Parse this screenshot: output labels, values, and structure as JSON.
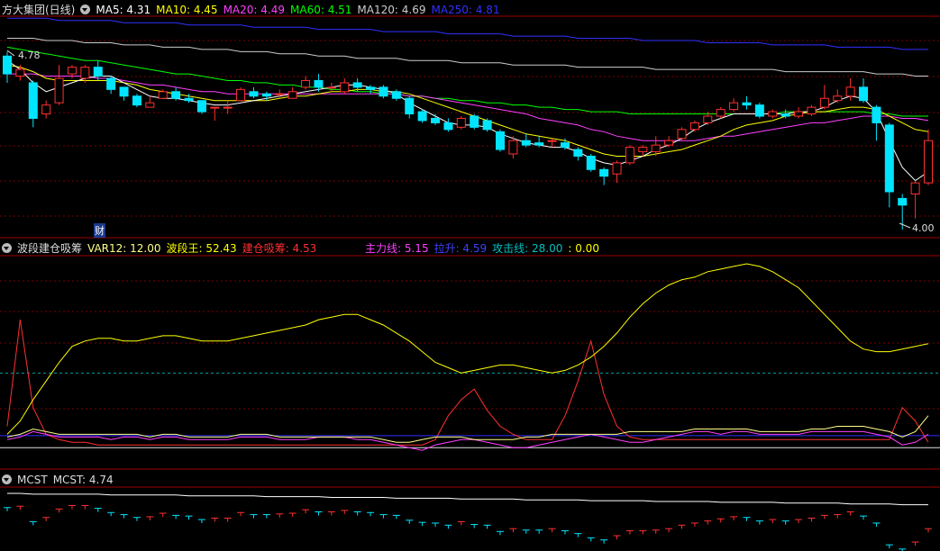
{
  "main": {
    "title": "方大集团(日线)",
    "ma": [
      {
        "label": "MA5: 4.31",
        "color": "#ffffff"
      },
      {
        "label": "MA10: 4.45",
        "color": "#ffff00"
      },
      {
        "label": "MA20: 4.49",
        "color": "#ff40ff"
      },
      {
        "label": "MA60: 4.51",
        "color": "#00ff00"
      },
      {
        "label": "MA120: 4.69",
        "color": "#cccccc"
      },
      {
        "label": "MA250: 4.81",
        "color": "#3030ff"
      }
    ],
    "high_label": "4.78",
    "low_label": "4.00",
    "cai_label": "财"
  },
  "osc": {
    "title": "波段建仓吸筹",
    "items": [
      {
        "label": "VAR12: 12.00",
        "color": "#ffff88"
      },
      {
        "label": "波段王: 52.43",
        "color": "#ffff00"
      },
      {
        "label": "建仓吸筹: 4.53",
        "color": "#ff3030"
      }
    ],
    "items2": [
      {
        "label": "主力线: 5.15",
        "color": "#ff40ff"
      },
      {
        "label": "拉升: 4.59",
        "color": "#4040ff"
      },
      {
        "label": "攻击线: 28.00",
        "color": "#00c0c0"
      },
      {
        "label": ": 0.00",
        "color": "#ffff00"
      }
    ]
  },
  "mcst": {
    "title": "MCST",
    "value": "MCST: 4.74"
  },
  "colors": {
    "up": "#ff3030",
    "down": "#00e5ff",
    "grid": "#7a0000",
    "border": "#a00000"
  },
  "chart_data": {
    "type": "candlestick",
    "price_range": [
      4.0,
      4.85
    ],
    "candles": [
      [
        4.78,
        4.7,
        4.8,
        4.66
      ],
      [
        4.69,
        4.72,
        4.74,
        4.67
      ],
      [
        4.66,
        4.5,
        4.67,
        4.46
      ],
      [
        4.52,
        4.56,
        4.58,
        4.5
      ],
      [
        4.57,
        4.68,
        4.74,
        4.56
      ],
      [
        4.7,
        4.73,
        4.74,
        4.68
      ],
      [
        4.68,
        4.73,
        4.74,
        4.66
      ],
      [
        4.73,
        4.69,
        4.76,
        4.67
      ],
      [
        4.68,
        4.63,
        4.69,
        4.61
      ],
      [
        4.64,
        4.6,
        4.64,
        4.58
      ],
      [
        4.6,
        4.56,
        4.61,
        4.55
      ],
      [
        4.55,
        4.57,
        4.6,
        4.55
      ],
      [
        4.59,
        4.62,
        4.63,
        4.59
      ],
      [
        4.62,
        4.59,
        4.64,
        4.58
      ],
      [
        4.59,
        4.58,
        4.61,
        4.57
      ],
      [
        4.58,
        4.53,
        4.58,
        4.52
      ],
      [
        4.55,
        4.55,
        4.55,
        4.49
      ],
      [
        4.55,
        4.55,
        4.58,
        4.52
      ],
      [
        4.58,
        4.63,
        4.64,
        4.58
      ],
      [
        4.62,
        4.6,
        4.64,
        4.59
      ],
      [
        4.61,
        4.6,
        4.62,
        4.58
      ],
      [
        4.61,
        4.61,
        4.63,
        4.59
      ],
      [
        4.59,
        4.62,
        4.64,
        4.59
      ],
      [
        4.64,
        4.67,
        4.69,
        4.63
      ],
      [
        4.67,
        4.64,
        4.7,
        4.62
      ],
      [
        4.64,
        4.64,
        4.66,
        4.62
      ],
      [
        4.62,
        4.66,
        4.68,
        4.61
      ],
      [
        4.66,
        4.64,
        4.68,
        4.62
      ],
      [
        4.64,
        4.63,
        4.65,
        4.61
      ],
      [
        4.64,
        4.6,
        4.65,
        4.59
      ],
      [
        4.62,
        4.59,
        4.63,
        4.58
      ],
      [
        4.59,
        4.52,
        4.6,
        4.5
      ],
      [
        4.53,
        4.49,
        4.54,
        4.48
      ],
      [
        4.5,
        4.48,
        4.52,
        4.47
      ],
      [
        4.48,
        4.45,
        4.5,
        4.44
      ],
      [
        4.46,
        4.5,
        4.51,
        4.45
      ],
      [
        4.51,
        4.46,
        4.52,
        4.45
      ],
      [
        4.49,
        4.45,
        4.5,
        4.44
      ],
      [
        4.44,
        4.36,
        4.45,
        4.35
      ],
      [
        4.34,
        4.4,
        4.42,
        4.32
      ],
      [
        4.4,
        4.38,
        4.43,
        4.37
      ],
      [
        4.39,
        4.38,
        4.42,
        4.37
      ],
      [
        4.4,
        4.4,
        4.41,
        4.37
      ],
      [
        4.39,
        4.37,
        4.41,
        4.36
      ],
      [
        4.36,
        4.33,
        4.37,
        4.31
      ],
      [
        4.33,
        4.27,
        4.34,
        4.26
      ],
      [
        4.27,
        4.24,
        4.28,
        4.2
      ],
      [
        4.25,
        4.3,
        4.31,
        4.21
      ],
      [
        4.3,
        4.37,
        4.38,
        4.29
      ],
      [
        4.35,
        4.37,
        4.38,
        4.33
      ],
      [
        4.35,
        4.38,
        4.42,
        4.33
      ],
      [
        4.38,
        4.4,
        4.42,
        4.37
      ],
      [
        4.41,
        4.45,
        4.46,
        4.4
      ],
      [
        4.45,
        4.48,
        4.49,
        4.44
      ],
      [
        4.48,
        4.51,
        4.53,
        4.47
      ],
      [
        4.51,
        4.54,
        4.55,
        4.5
      ],
      [
        4.54,
        4.57,
        4.59,
        4.53
      ],
      [
        4.57,
        4.56,
        4.6,
        4.54
      ],
      [
        4.56,
        4.51,
        4.57,
        4.5
      ],
      [
        4.51,
        4.53,
        4.54,
        4.5
      ],
      [
        4.52,
        4.51,
        4.54,
        4.5
      ],
      [
        4.51,
        4.53,
        4.55,
        4.5
      ],
      [
        4.52,
        4.55,
        4.56,
        4.51
      ],
      [
        4.55,
        4.59,
        4.65,
        4.54
      ],
      [
        4.58,
        4.6,
        4.63,
        4.57
      ],
      [
        4.6,
        4.64,
        4.68,
        4.58
      ],
      [
        4.64,
        4.58,
        4.68,
        4.57
      ],
      [
        4.55,
        4.48,
        4.56,
        4.4
      ],
      [
        4.47,
        4.17,
        4.48,
        4.1
      ],
      [
        4.14,
        4.11,
        4.16,
        4.0
      ],
      [
        4.16,
        4.21,
        4.22,
        4.05
      ],
      [
        4.21,
        4.4,
        4.45,
        4.2
      ]
    ],
    "ma5": [
      4.76,
      4.72,
      4.66,
      4.62,
      4.64,
      4.66,
      4.68,
      4.69,
      4.69,
      4.66,
      4.63,
      4.6,
      4.59,
      4.59,
      4.58,
      4.57,
      4.56,
      4.56,
      4.57,
      4.58,
      4.59,
      4.6,
      4.61,
      4.62,
      4.63,
      4.64,
      4.65,
      4.65,
      4.64,
      4.63,
      4.61,
      4.57,
      4.54,
      4.51,
      4.48,
      4.47,
      4.47,
      4.46,
      4.43,
      4.41,
      4.39,
      4.38,
      4.37,
      4.37,
      4.35,
      4.32,
      4.3,
      4.29,
      4.31,
      4.33,
      4.36,
      4.38,
      4.41,
      4.45,
      4.48,
      4.5,
      4.52,
      4.52,
      4.52,
      4.52,
      4.52,
      4.53,
      4.53,
      4.55,
      4.58,
      4.6,
      4.59,
      4.53,
      4.4,
      4.28,
      4.22,
      4.26
    ],
    "ma10": [
      4.74,
      4.73,
      4.71,
      4.68,
      4.67,
      4.67,
      4.67,
      4.67,
      4.67,
      4.66,
      4.65,
      4.63,
      4.62,
      4.61,
      4.6,
      4.59,
      4.58,
      4.58,
      4.58,
      4.58,
      4.58,
      4.59,
      4.6,
      4.6,
      4.61,
      4.62,
      4.62,
      4.63,
      4.63,
      4.62,
      4.62,
      4.61,
      4.59,
      4.57,
      4.55,
      4.53,
      4.51,
      4.49,
      4.47,
      4.45,
      4.43,
      4.42,
      4.41,
      4.4,
      4.38,
      4.36,
      4.34,
      4.33,
      4.33,
      4.33,
      4.34,
      4.35,
      4.36,
      4.38,
      4.4,
      4.42,
      4.45,
      4.47,
      4.48,
      4.49,
      4.51,
      4.52,
      4.53,
      4.53,
      4.54,
      4.55,
      4.55,
      4.54,
      4.51,
      4.48,
      4.45,
      4.44
    ],
    "ma20": [
      4.7,
      4.7,
      4.7,
      4.69,
      4.69,
      4.69,
      4.69,
      4.68,
      4.68,
      4.67,
      4.66,
      4.65,
      4.65,
      4.64,
      4.63,
      4.62,
      4.62,
      4.61,
      4.61,
      4.61,
      4.61,
      4.61,
      4.61,
      4.61,
      4.61,
      4.61,
      4.61,
      4.61,
      4.61,
      4.61,
      4.61,
      4.6,
      4.6,
      4.59,
      4.58,
      4.57,
      4.56,
      4.55,
      4.54,
      4.53,
      4.52,
      4.5,
      4.49,
      4.48,
      4.47,
      4.45,
      4.44,
      4.42,
      4.41,
      4.4,
      4.4,
      4.4,
      4.4,
      4.4,
      4.41,
      4.42,
      4.42,
      4.43,
      4.44,
      4.45,
      4.46,
      4.47,
      4.48,
      4.48,
      4.49,
      4.5,
      4.51,
      4.51,
      4.51,
      4.5,
      4.5,
      4.49
    ],
    "ma60": [
      4.82,
      4.81,
      4.8,
      4.79,
      4.78,
      4.77,
      4.76,
      4.76,
      4.75,
      4.74,
      4.73,
      4.72,
      4.71,
      4.7,
      4.7,
      4.69,
      4.68,
      4.67,
      4.67,
      4.66,
      4.66,
      4.65,
      4.65,
      4.64,
      4.64,
      4.63,
      4.63,
      4.62,
      4.62,
      4.61,
      4.61,
      4.6,
      4.6,
      4.59,
      4.59,
      4.58,
      4.58,
      4.57,
      4.57,
      4.56,
      4.56,
      4.55,
      4.55,
      4.54,
      4.54,
      4.53,
      4.53,
      4.53,
      4.52,
      4.52,
      4.52,
      4.52,
      4.52,
      4.52,
      4.52,
      4.52,
      4.52,
      4.52,
      4.52,
      4.52,
      4.53,
      4.53,
      4.53,
      4.53,
      4.53,
      4.53,
      4.53,
      4.52,
      4.52,
      4.51,
      4.51,
      4.51
    ],
    "ma120": [
      4.86,
      4.86,
      4.86,
      4.85,
      4.85,
      4.85,
      4.84,
      4.84,
      4.84,
      4.83,
      4.83,
      4.83,
      4.82,
      4.82,
      4.82,
      4.81,
      4.81,
      4.81,
      4.8,
      4.8,
      4.8,
      4.79,
      4.79,
      4.79,
      4.78,
      4.78,
      4.78,
      4.77,
      4.77,
      4.77,
      4.77,
      4.76,
      4.76,
      4.76,
      4.76,
      4.75,
      4.75,
      4.75,
      4.75,
      4.74,
      4.74,
      4.74,
      4.74,
      4.74,
      4.73,
      4.73,
      4.73,
      4.73,
      4.73,
      4.73,
      4.72,
      4.72,
      4.72,
      4.72,
      4.72,
      4.72,
      4.72,
      4.72,
      4.72,
      4.72,
      4.71,
      4.71,
      4.71,
      4.71,
      4.71,
      4.71,
      4.71,
      4.7,
      4.7,
      4.7,
      4.69,
      4.69
    ],
    "ma250": [
      4.95,
      4.95,
      4.95,
      4.95,
      4.94,
      4.94,
      4.94,
      4.94,
      4.94,
      4.93,
      4.93,
      4.93,
      4.93,
      4.93,
      4.92,
      4.92,
      4.92,
      4.92,
      4.92,
      4.91,
      4.91,
      4.91,
      4.91,
      4.91,
      4.9,
      4.9,
      4.9,
      4.9,
      4.9,
      4.89,
      4.89,
      4.89,
      4.89,
      4.89,
      4.88,
      4.88,
      4.88,
      4.88,
      4.88,
      4.87,
      4.87,
      4.87,
      4.87,
      4.87,
      4.86,
      4.86,
      4.86,
      4.86,
      4.86,
      4.85,
      4.85,
      4.85,
      4.85,
      4.85,
      4.84,
      4.84,
      4.84,
      4.84,
      4.84,
      4.83,
      4.83,
      4.83,
      4.83,
      4.83,
      4.82,
      4.82,
      4.82,
      4.82,
      4.82,
      4.81,
      4.81,
      4.81
    ],
    "osc_range": [
      -5,
      70
    ],
    "wave_king": [
      5,
      10,
      18,
      25,
      32,
      38,
      40,
      41,
      41,
      40,
      40,
      41,
      42,
      42,
      41,
      40,
      40,
      40,
      41,
      42,
      43,
      44,
      45,
      46,
      48,
      49,
      50,
      50,
      48,
      46,
      43,
      40,
      36,
      32,
      30,
      28,
      29,
      30,
      31,
      31,
      30,
      29,
      28,
      29,
      31,
      34,
      38,
      43,
      49,
      54,
      58,
      61,
      63,
      64,
      66,
      67,
      68,
      69,
      68,
      66,
      63,
      60,
      55,
      50,
      45,
      40,
      37,
      36,
      36,
      37,
      38,
      39
    ],
    "build": [
      8,
      48,
      15,
      5,
      3,
      2,
      2,
      1,
      1,
      1,
      1,
      1,
      1,
      1,
      1,
      1,
      1,
      1,
      1,
      1,
      1,
      1,
      1,
      1,
      1,
      1,
      1,
      1,
      1,
      1,
      1,
      1,
      1,
      3,
      12,
      18,
      22,
      14,
      8,
      5,
      3,
      3,
      3,
      12,
      25,
      40,
      20,
      8,
      4,
      3,
      3,
      3,
      3,
      3,
      3,
      3,
      3,
      3,
      3,
      3,
      3,
      3,
      3,
      3,
      3,
      3,
      3,
      3,
      3,
      15,
      10,
      2
    ],
    "main_force": [
      3,
      4,
      6,
      5,
      4,
      4,
      4,
      4,
      3,
      4,
      4,
      3,
      4,
      4,
      3,
      3,
      3,
      3,
      4,
      4,
      4,
      3,
      3,
      3,
      4,
      4,
      4,
      3,
      3,
      2,
      1,
      0,
      -1,
      1,
      2,
      3,
      3,
      2,
      1,
      0,
      0,
      1,
      2,
      3,
      4,
      5,
      4,
      3,
      2,
      2,
      3,
      4,
      5,
      6,
      6,
      5,
      6,
      6,
      5,
      5,
      5,
      5,
      6,
      6,
      6,
      6,
      6,
      5,
      4,
      1,
      2,
      5
    ],
    "lift": [
      2,
      3,
      3,
      3,
      3,
      3,
      3,
      3,
      3,
      3,
      3,
      3,
      3,
      3,
      3,
      3,
      3,
      3,
      3,
      3,
      3,
      3,
      3,
      3,
      3,
      3,
      3,
      3,
      3,
      3,
      3,
      3,
      3,
      3,
      3,
      3,
      3,
      3,
      3,
      3,
      3,
      3,
      3,
      3,
      3,
      3,
      3,
      3,
      3,
      3,
      3,
      3,
      3,
      3,
      3,
      3,
      3,
      3,
      3,
      3,
      3,
      3,
      3,
      3,
      3,
      3,
      3,
      3,
      3,
      3,
      3,
      3
    ],
    "var12": [
      4,
      5,
      7,
      6,
      5,
      5,
      5,
      5,
      5,
      5,
      5,
      4,
      5,
      5,
      4,
      4,
      4,
      4,
      5,
      5,
      5,
      4,
      4,
      4,
      4,
      4,
      4,
      4,
      4,
      3,
      2,
      2,
      3,
      4,
      4,
      4,
      3,
      3,
      3,
      3,
      4,
      4,
      5,
      5,
      5,
      5,
      5,
      5,
      6,
      6,
      6,
      6,
      6,
      7,
      7,
      7,
      7,
      7,
      6,
      6,
      6,
      6,
      7,
      7,
      8,
      8,
      8,
      7,
      6,
      4,
      6,
      12
    ],
    "attack_level": 28.0,
    "mcst_range": [
      4.0,
      5.0
    ],
    "mcst_upper": [
      4.97,
      4.97,
      4.96,
      4.96,
      4.96,
      4.96,
      4.96,
      4.96,
      4.95,
      4.95,
      4.95,
      4.95,
      4.95,
      4.95,
      4.94,
      4.94,
      4.94,
      4.94,
      4.94,
      4.94,
      4.93,
      4.93,
      4.93,
      4.93,
      4.93,
      4.92,
      4.92,
      4.92,
      4.92,
      4.92,
      4.91,
      4.91,
      4.91,
      4.91,
      4.91,
      4.9,
      4.9,
      4.9,
      4.9,
      4.9,
      4.89,
      4.89,
      4.89,
      4.89,
      4.89,
      4.88,
      4.88,
      4.88,
      4.88,
      4.88,
      4.87,
      4.87,
      4.87,
      4.87,
      4.87,
      4.86,
      4.86,
      4.86,
      4.86,
      4.86,
      4.85,
      4.85,
      4.85,
      4.85,
      4.85,
      4.84,
      4.84,
      4.84,
      4.84,
      4.83,
      4.83,
      4.83
    ],
    "mcst": [
      4.74,
      4.74,
      4.73,
      4.73,
      4.73,
      4.73,
      4.73,
      4.73,
      4.73,
      4.73,
      4.72,
      4.72,
      4.72,
      4.72,
      4.72,
      4.72,
      4.72,
      4.71,
      4.71,
      4.71,
      4.71,
      4.71,
      4.71,
      4.71,
      4.71,
      4.71,
      4.71,
      4.71,
      4.71,
      4.71,
      4.71,
      4.7,
      4.7,
      4.7,
      4.7,
      4.7,
      4.7,
      4.7,
      4.7,
      4.7,
      4.7,
      4.7,
      4.7,
      4.7,
      4.7,
      4.7,
      4.7,
      4.7,
      4.7,
      4.7,
      4.7,
      4.7,
      4.7,
      4.7,
      4.7,
      4.7,
      4.7,
      4.7,
      4.7,
      4.7,
      4.7,
      4.7,
      4.71,
      4.71,
      4.71,
      4.72,
      4.72,
      4.72,
      4.73,
      4.73,
      4.74,
      4.74
    ]
  }
}
